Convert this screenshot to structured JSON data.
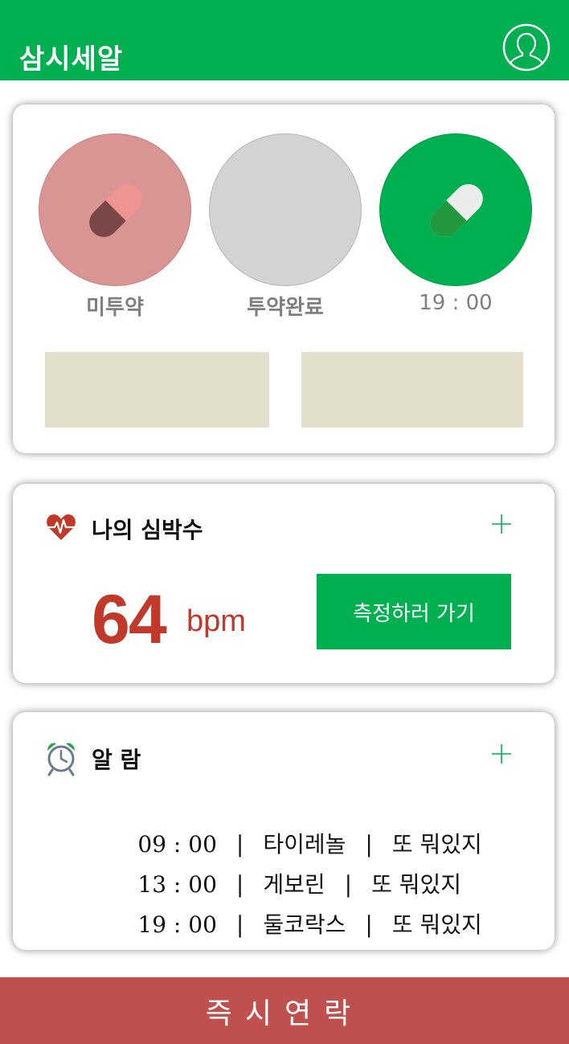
{
  "header": {
    "title": "삼시세알",
    "profile_icon": "user-profile-icon"
  },
  "medication_status": {
    "items": [
      {
        "label": "미투약",
        "icon": "pill-icon",
        "color": "#d99594"
      },
      {
        "label": "투약완료",
        "icon": "",
        "color": "#d3d3d3"
      },
      {
        "label": "19 : 00",
        "icon": "pill-icon",
        "color": "#00b050"
      }
    ]
  },
  "heart_rate": {
    "title": "나의 심박수",
    "icon": "heart-pulse-icon",
    "add_icon": "plus-icon",
    "value": "64",
    "unit": "bpm",
    "button_label": "측정하러 가기"
  },
  "alarms": {
    "title": "알 람",
    "icon": "alarm-clock-icon",
    "add_icon": "plus-icon",
    "rows": [
      {
        "time": "09 : 00",
        "medicine": "타이레놀",
        "note": "또 뭐있지"
      },
      {
        "time": "13 : 00",
        "medicine": "게보린",
        "note": "또 뭐있지"
      },
      {
        "time": "19 : 00",
        "medicine": "둘코락스",
        "note": "또 뭐있지"
      }
    ],
    "separator": "|"
  },
  "emergency": {
    "label": "즉시연락"
  },
  "colors": {
    "brand_green": "#00b050",
    "emergency_red": "#c0504d",
    "heart_red": "#c0392b"
  }
}
